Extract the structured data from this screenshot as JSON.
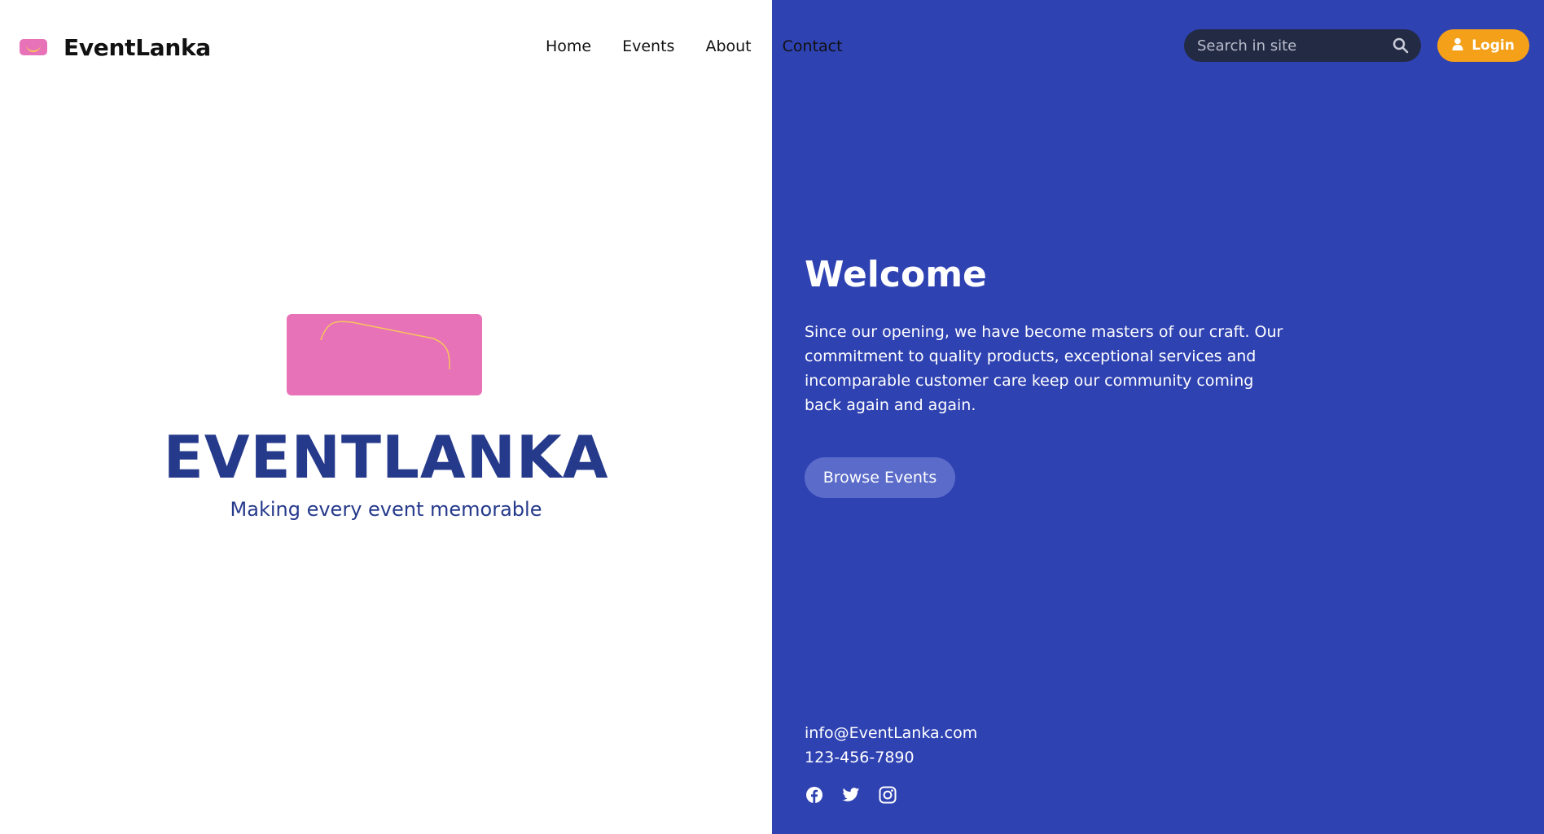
{
  "brand": {
    "name": "EventLanka",
    "icon": "ticket-logo-icon",
    "color": "#e872b8"
  },
  "nav": {
    "items": [
      {
        "label": "Home"
      },
      {
        "label": "Events"
      },
      {
        "label": "About"
      },
      {
        "label": "Contact"
      }
    ]
  },
  "search": {
    "placeholder": "Search in site",
    "icon": "search-icon",
    "bg_color": "#232a44"
  },
  "login": {
    "label": "Login",
    "icon": "user-icon",
    "color": "#f4a018"
  },
  "hero": {
    "title": "EVENTLANKA",
    "tagline": "Making every event memorable",
    "card_color": "#e872b8",
    "title_color": "#263a8c"
  },
  "welcome": {
    "title": "Welcome",
    "body": "Since our opening, we have become masters of our craft. Our commitment to quality products, exceptional services and incomparable customer care keep our community coming back again and again.",
    "button_label": "Browse Events",
    "panel_color": "#2f42b2"
  },
  "contact": {
    "email": "info@EventLanka.com",
    "phone": "123-456-7890"
  },
  "social": [
    {
      "icon": "facebook-icon"
    },
    {
      "icon": "twitter-icon"
    },
    {
      "icon": "instagram-icon"
    }
  ]
}
